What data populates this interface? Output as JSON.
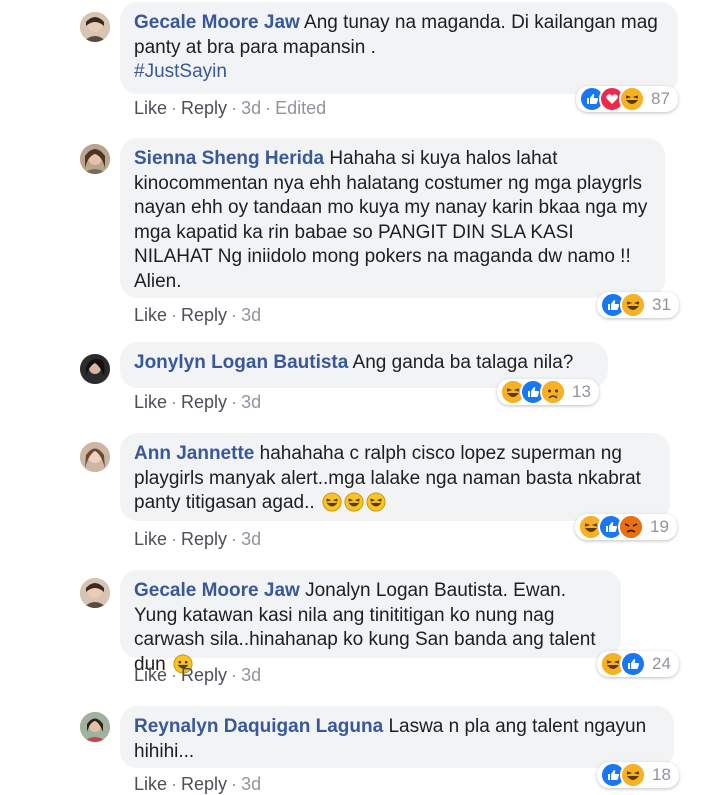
{
  "comments": [
    {
      "author": "Gecale Moore Jaw",
      "text": "Ang tunay na maganda. Di kailangan mag panty at bra para mapansin .",
      "hashtag": "#JustSayin",
      "like": "Like",
      "reply": "Reply",
      "time": "3d",
      "edited": "Edited",
      "reactions": [
        "like",
        "love",
        "haha"
      ],
      "count": "87"
    },
    {
      "author": "Sienna Sheng Herida",
      "text": "Hahaha si kuya halos lahat kinocommentan nya ehh halatang costumer ng mga playgrls nayan ehh oy tandaan mo kuya my nanay karin bkaa nga my mga kapatid ka rin babae so PANGIT DIN SLA KASI NILAHAT Ng iniidolo mong pokers na maganda dw namo !! Alien.",
      "like": "Like",
      "reply": "Reply",
      "time": "3d",
      "reactions": [
        "like",
        "haha"
      ],
      "count": "31"
    },
    {
      "author": "Jonylyn Logan Bautista",
      "text": "Ang ganda ba talaga nila?",
      "like": "Like",
      "reply": "Reply",
      "time": "3d",
      "reactions": [
        "haha",
        "like",
        "sad"
      ],
      "count": "13"
    },
    {
      "author": "Ann Jannette",
      "text": "hahahaha c ralph cisco lopez superman ng playgirls manyak alert..mga lalake nga naman basta nkabrat panty titigasan agad..",
      "like": "Like",
      "reply": "Reply",
      "time": "3d",
      "reactions": [
        "haha",
        "like",
        "angry"
      ],
      "count": "19"
    },
    {
      "author": "Gecale Moore Jaw",
      "text": "Jonalyn Logan Bautista. Ewan. Yung katawan kasi nila ang tinititigan ko nung nag carwash sila..hinahanap ko kung San banda ang talent dun",
      "like": "Like",
      "reply": "Reply",
      "time": "3d",
      "reactions": [
        "haha",
        "like"
      ],
      "count": "24"
    },
    {
      "author": "Reynalyn Daquigan Laguna",
      "text": "Laswa n pla ang talent ngayun hihihi...",
      "like": "Like",
      "reply": "Reply",
      "time": "3d",
      "reactions": [
        "like",
        "haha"
      ],
      "count": "18"
    }
  ],
  "colors": {
    "author": "#385898",
    "bubble": "#f2f3f5",
    "like": "#1877f2",
    "love": "#f0284a",
    "haha": "#f7b125"
  }
}
